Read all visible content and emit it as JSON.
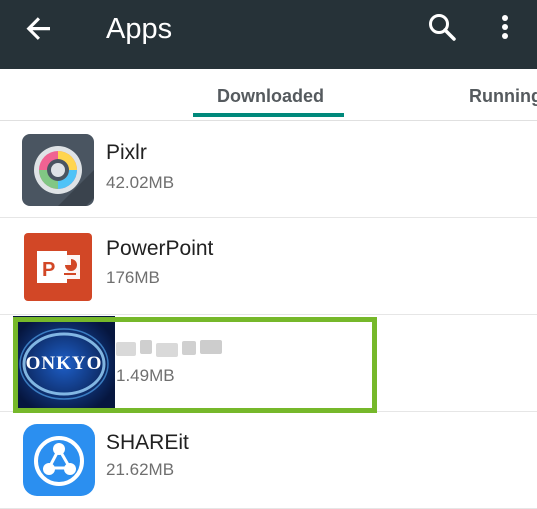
{
  "appbar": {
    "title": "Apps"
  },
  "tabs": [
    {
      "label": "Downloaded",
      "selected": true
    },
    {
      "label": "Running",
      "selected": false
    }
  ],
  "apps": [
    {
      "name": "Pixlr",
      "size": "42.02MB",
      "icon": "pixlr-icon"
    },
    {
      "name": "PowerPoint",
      "size": "176MB",
      "icon": "powerpoint-icon"
    },
    {
      "name": "",
      "size": "1.49MB",
      "icon": "onkyo-icon",
      "icon_text": "ONKYO",
      "highlighted": true
    },
    {
      "name": "SHAREit",
      "size": "21.62MB",
      "icon": "shareit-icon"
    }
  ],
  "colors": {
    "appbar": "#263238",
    "tab_indicator": "#00897b",
    "highlight": "#76b82a",
    "powerpoint": "#d24726",
    "shareit": "#2b8ff0",
    "onkyo": "#0d2b6b"
  }
}
